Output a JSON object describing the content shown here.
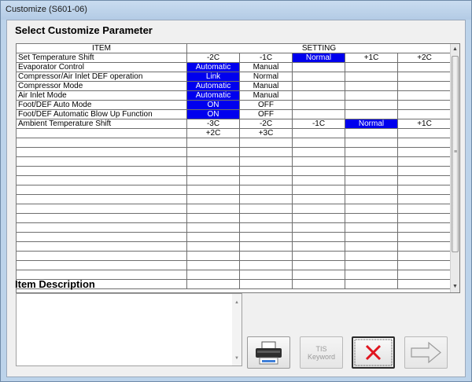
{
  "window": {
    "title": "Customize (S601-06)"
  },
  "sections": {
    "select_title": "Select Customize Parameter",
    "description_title": "Item Description"
  },
  "table": {
    "headers": {
      "item": "ITEM",
      "setting": "SETTING"
    },
    "rows": [
      {
        "item": "Set Temperature Shift",
        "settings": [
          "-2C",
          "-1C",
          "Normal",
          "+1C",
          "+2C"
        ],
        "selected": 2
      },
      {
        "item": "Evaporator Control",
        "settings": [
          "Automatic",
          "Manual",
          "",
          "",
          ""
        ],
        "selected": 0
      },
      {
        "item": "Compressor/Air Inlet DEF operation",
        "settings": [
          "Link",
          "Normal",
          "",
          "",
          ""
        ],
        "selected": 0
      },
      {
        "item": "Compressor Mode",
        "settings": [
          "Automatic",
          "Manual",
          "",
          "",
          ""
        ],
        "selected": 0
      },
      {
        "item": "Air Inlet Mode",
        "settings": [
          "Automatic",
          "Manual",
          "",
          "",
          ""
        ],
        "selected": 0
      },
      {
        "item": "Foot/DEF Auto Mode",
        "settings": [
          "ON",
          "OFF",
          "",
          "",
          ""
        ],
        "selected": 0
      },
      {
        "item": "Foot/DEF Automatic Blow Up Function",
        "settings": [
          "ON",
          "OFF",
          "",
          "",
          ""
        ],
        "selected": 0
      },
      {
        "item": "Ambient Temperature Shift",
        "settings": [
          "-3C",
          "-2C",
          "-1C",
          "Normal",
          "+1C"
        ],
        "selected": 3
      },
      {
        "item": "",
        "settings": [
          "+2C",
          "+3C",
          "",
          "",
          ""
        ],
        "selected": -1
      },
      {
        "item": "",
        "settings": [
          "",
          "",
          "",
          "",
          ""
        ],
        "selected": -1
      },
      {
        "item": "",
        "settings": [
          "",
          "",
          "",
          "",
          ""
        ],
        "selected": -1
      },
      {
        "item": "",
        "settings": [
          "",
          "",
          "",
          "",
          ""
        ],
        "selected": -1
      },
      {
        "item": "",
        "settings": [
          "",
          "",
          "",
          "",
          ""
        ],
        "selected": -1
      },
      {
        "item": "",
        "settings": [
          "",
          "",
          "",
          "",
          ""
        ],
        "selected": -1
      },
      {
        "item": "",
        "settings": [
          "",
          "",
          "",
          "",
          ""
        ],
        "selected": -1
      },
      {
        "item": "",
        "settings": [
          "",
          "",
          "",
          "",
          ""
        ],
        "selected": -1
      },
      {
        "item": "",
        "settings": [
          "",
          "",
          "",
          "",
          ""
        ],
        "selected": -1
      },
      {
        "item": "",
        "settings": [
          "",
          "",
          "",
          "",
          ""
        ],
        "selected": -1
      },
      {
        "item": "",
        "settings": [
          "",
          "",
          "",
          "",
          ""
        ],
        "selected": -1
      },
      {
        "item": "",
        "settings": [
          "",
          "",
          "",
          "",
          ""
        ],
        "selected": -1
      },
      {
        "item": "",
        "settings": [
          "",
          "",
          "",
          "",
          ""
        ],
        "selected": -1
      },
      {
        "item": "",
        "settings": [
          "",
          "",
          "",
          "",
          ""
        ],
        "selected": -1
      },
      {
        "item": "",
        "settings": [
          "",
          "",
          "",
          "",
          ""
        ],
        "selected": -1
      },
      {
        "item": "",
        "settings": [
          "",
          "",
          "",
          "",
          ""
        ],
        "selected": -1
      },
      {
        "item": "",
        "settings": [
          "",
          "",
          "",
          "",
          ""
        ],
        "selected": -1
      }
    ]
  },
  "description": {
    "value": ""
  },
  "buttons": {
    "print": {
      "icon": "printer-icon"
    },
    "tis_keyword": {
      "label_top": "TIS",
      "label_bottom": "Keyword",
      "enabled": false
    },
    "cancel": {
      "icon": "close-icon"
    },
    "next": {
      "icon": "arrow-right-icon",
      "enabled": false
    }
  },
  "colors": {
    "selection": "#0000ee",
    "selection_text": "#ffffff"
  }
}
